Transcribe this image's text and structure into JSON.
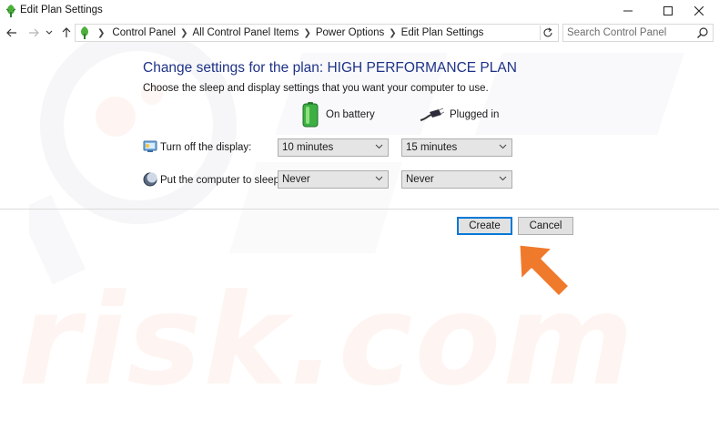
{
  "window": {
    "title": "Edit Plan Settings",
    "controls": {
      "minimize": "minimize-icon",
      "maximize": "maximize-icon",
      "close": "close-icon"
    }
  },
  "address_bar": {
    "breadcrumbs": [
      "Control Panel",
      "All Control Panel Items",
      "Power Options",
      "Edit Plan Settings"
    ],
    "search_placeholder": "Search Control Panel"
  },
  "main": {
    "heading": "Change settings for the plan: HIGH PERFORMANCE PLAN",
    "subheading": "Choose the sleep and display settings that you want your computer to use.",
    "columns": {
      "battery": "On battery",
      "plugged": "Plugged in"
    },
    "rows": [
      {
        "label": "Turn off the display:",
        "battery_value": "10 minutes",
        "plugged_value": "15 minutes",
        "icon": "display-icon"
      },
      {
        "label": "Put the computer to sleep:",
        "battery_value": "Never",
        "plugged_value": "Never",
        "icon": "sleep-moon-icon"
      }
    ],
    "buttons": {
      "create": "Create",
      "cancel": "Cancel"
    }
  },
  "watermark": {
    "text": "risk.com"
  },
  "colors": {
    "heading": "#1e3287",
    "accent": "#0078d7",
    "annotation_arrow": "#f07a2b"
  }
}
